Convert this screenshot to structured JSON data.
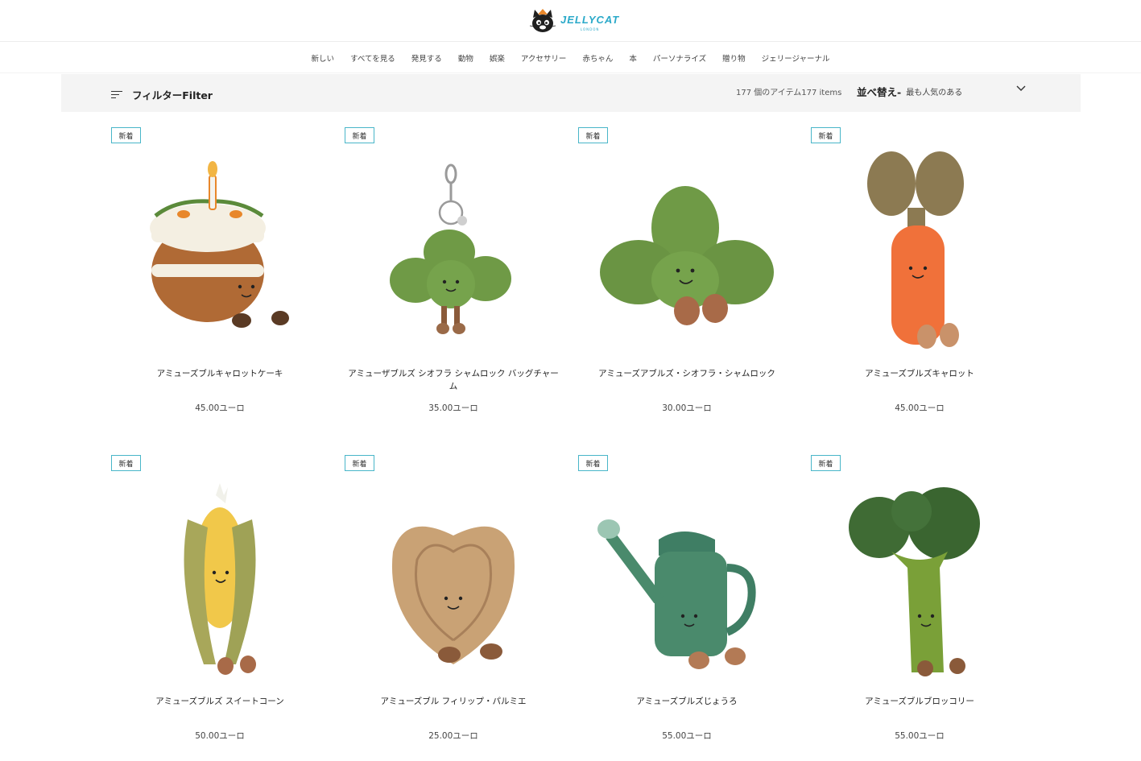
{
  "brand": {
    "name": "JELLYCAT",
    "sub": "LONDON"
  },
  "nav": [
    "新しい",
    "すべてを見る",
    "発見する",
    "動物",
    "娯楽",
    "アクセサリー",
    "赤ちゃん",
    "本",
    "パーソナライズ",
    "贈り物",
    "ジェリージャーナル"
  ],
  "toolbar": {
    "filter_label": "フィルターFilter",
    "item_count": "177 個のアイテム177 items",
    "sort_label": "並べ替え-",
    "sort_value": "最も人気のある"
  },
  "products": [
    {
      "badge": "新着",
      "name": "アミューズブルキャロットケーキ",
      "price": "45.00ユーロ",
      "icon": "carrot-cake-plush"
    },
    {
      "badge": "新着",
      "name": "アミューザブルズ シオフラ シャムロック バッグチャーム",
      "price": "35.00ユーロ",
      "icon": "shamrock-bag-charm-plush"
    },
    {
      "badge": "新着",
      "name": "アミューズアブルズ・シオフラ・シャムロック",
      "price": "30.00ユーロ",
      "icon": "shamrock-plush"
    },
    {
      "badge": "新着",
      "name": "アミューズブルズキャロット",
      "price": "45.00ユーロ",
      "icon": "carrot-plush"
    },
    {
      "badge": "新着",
      "name": "アミューズブルズ スイートコーン",
      "price": "50.00ユーロ",
      "icon": "sweetcorn-plush"
    },
    {
      "badge": "新着",
      "name": "アミューズブル フィリップ・パルミエ",
      "price": "25.00ユーロ",
      "icon": "palmier-plush"
    },
    {
      "badge": "新着",
      "name": "アミューズブルズじょうろ",
      "price": "55.00ユーロ",
      "icon": "watering-can-plush"
    },
    {
      "badge": "新着",
      "name": "アミューズブルブロッコリー",
      "price": "55.00ユーロ",
      "icon": "broccoli-plush"
    }
  ],
  "colors": {
    "badge_border": "#49b6c9",
    "filter_bg": "#f4f4f4",
    "brand": "#2aa9c9"
  }
}
